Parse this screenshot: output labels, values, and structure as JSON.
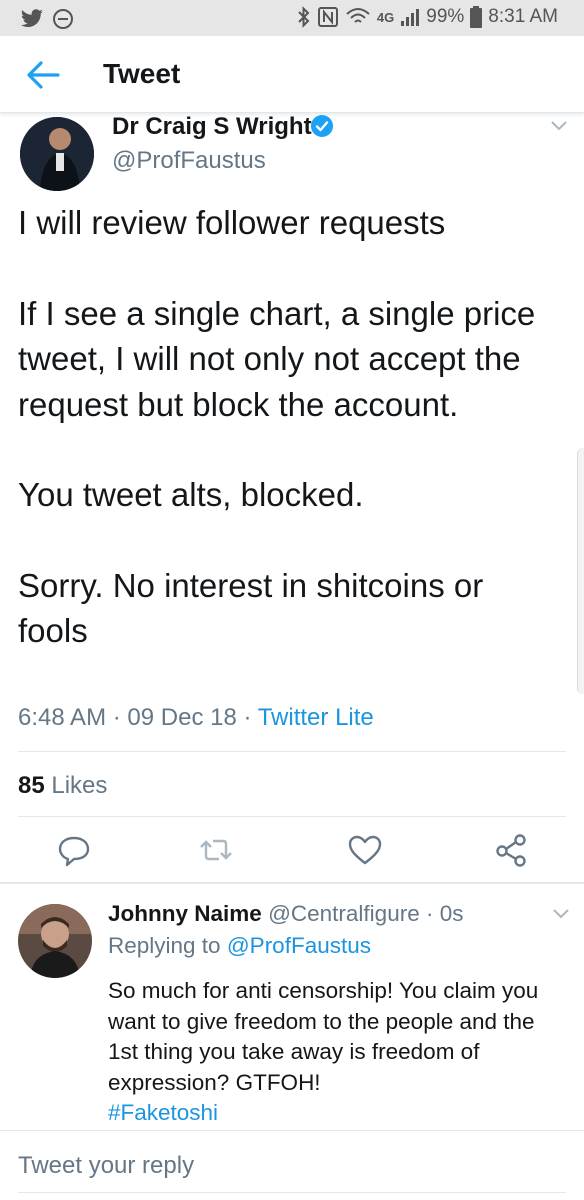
{
  "status_bar": {
    "battery": "99%",
    "time": "8:31 AM",
    "network": "4G",
    "left_icons": [
      "twitter-bird-icon",
      "do-not-disturb-icon"
    ],
    "right_icons": [
      "bluetooth-icon",
      "nfc-icon",
      "wifi-icon",
      "signal-icon",
      "battery-icon"
    ]
  },
  "header": {
    "title": "Tweet"
  },
  "tweet": {
    "author_name": "Dr Craig S Wright",
    "author_handle": "@ProfFaustus",
    "verified": true,
    "paragraphs": [
      "I will review follower requests",
      "If I see a single chart, a single price tweet, I will not only not accept the request but block the account.",
      "You tweet alts, blocked.",
      "Sorry. No interest in shitcoins or fools"
    ],
    "time": "6:48 AM",
    "date": "09 Dec 18",
    "separator": "·",
    "source": "Twitter Lite",
    "likes_count": "85",
    "likes_label": "Likes"
  },
  "reply": {
    "author_name": "Johnny Naime",
    "author_handle": "@Centralfigure",
    "time": "0s",
    "replying_prefix": "Replying to",
    "replying_handle": "@ProfFaustus",
    "text": "So much for anti censorship! You claim you want to give freedom to the people and the 1st thing you take away is freedom of expression? GTFOH!",
    "hashtag": "#Faketoshi"
  },
  "composer": {
    "placeholder": "Tweet your reply"
  },
  "colors": {
    "accent": "#1da1f2",
    "link": "#1b95e0",
    "muted": "#657786",
    "text": "#14171a"
  }
}
